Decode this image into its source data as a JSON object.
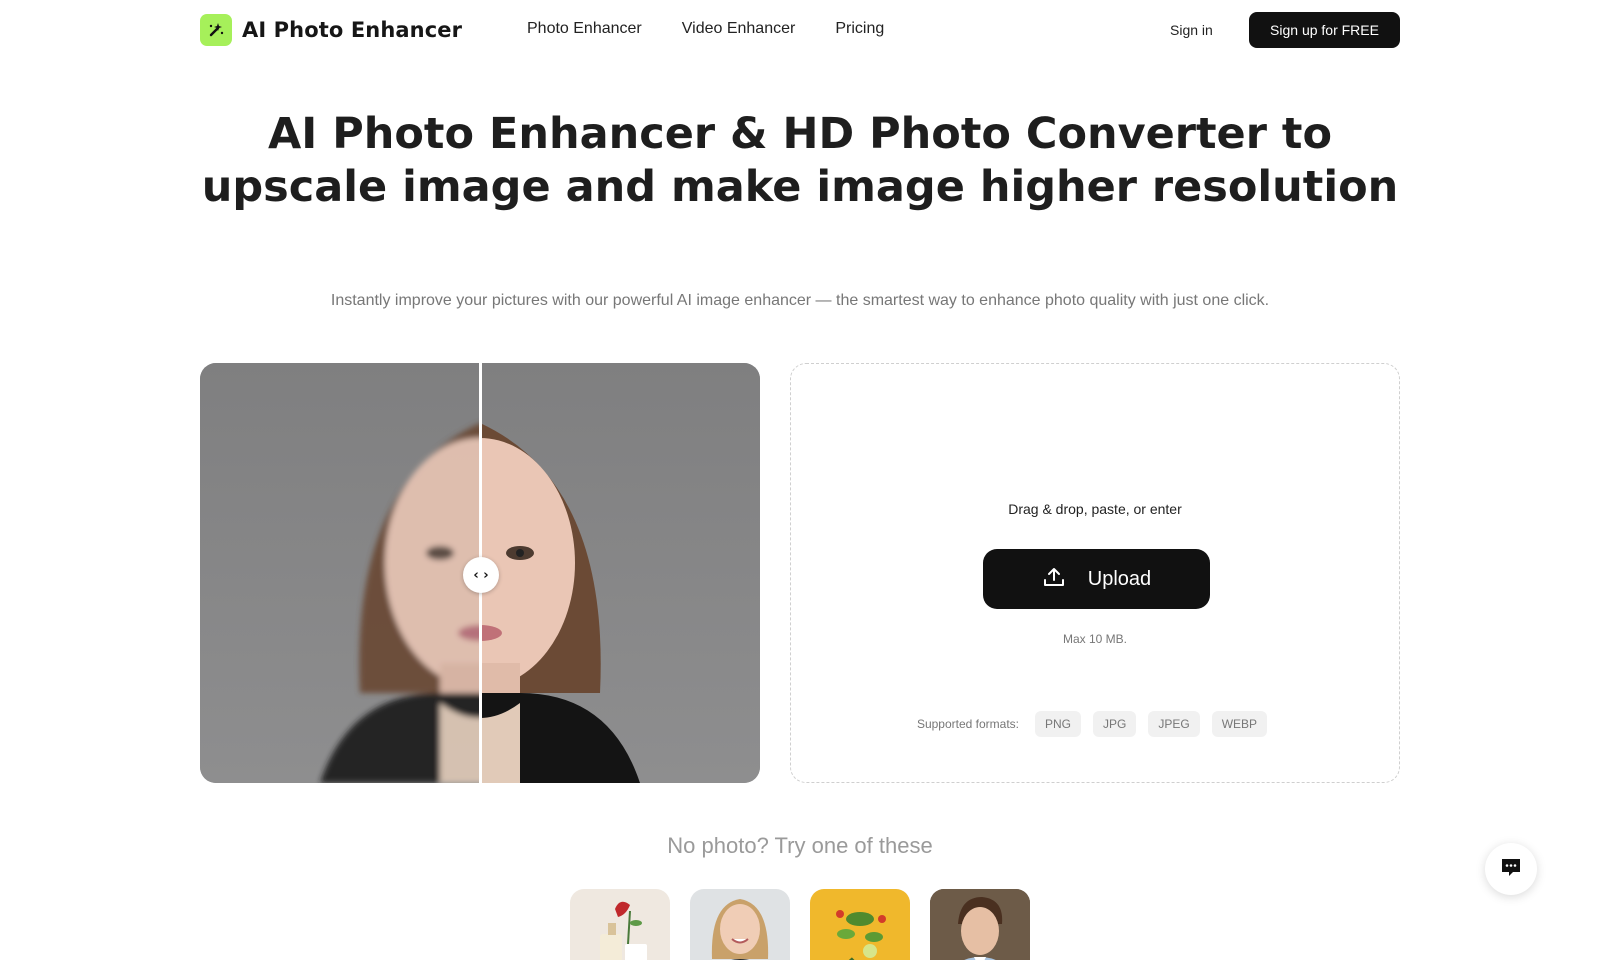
{
  "header": {
    "logo_text": "AI Photo Enhancer",
    "nav": [
      "Photo Enhancer",
      "Video Enhancer",
      "Pricing"
    ],
    "signin_label": "Sign in",
    "signup_label": "Sign up for FREE"
  },
  "hero": {
    "title": "AI Photo Enhancer & HD Photo Converter to upscale image and make image higher resolution",
    "subtitle": "Instantly improve your pictures with our powerful AI image enhancer — the smartest way to enhance photo quality with just one click."
  },
  "compare": {
    "handle_glyph": "‹ ›"
  },
  "upload": {
    "drag_text": "Drag & drop, paste, or enter",
    "button_label": "Upload",
    "max_size": "Max 10 MB.",
    "formats_label": "Supported formats:",
    "formats": [
      "PNG",
      "JPG",
      "JPEG",
      "WEBP"
    ]
  },
  "samples": {
    "title": "No photo? Try one of these"
  },
  "icons": {
    "logo": "magic-wand-icon",
    "upload": "upload-icon",
    "chat": "chat-icon"
  },
  "colors": {
    "accent": "#a6f05a",
    "dark": "#111111"
  }
}
